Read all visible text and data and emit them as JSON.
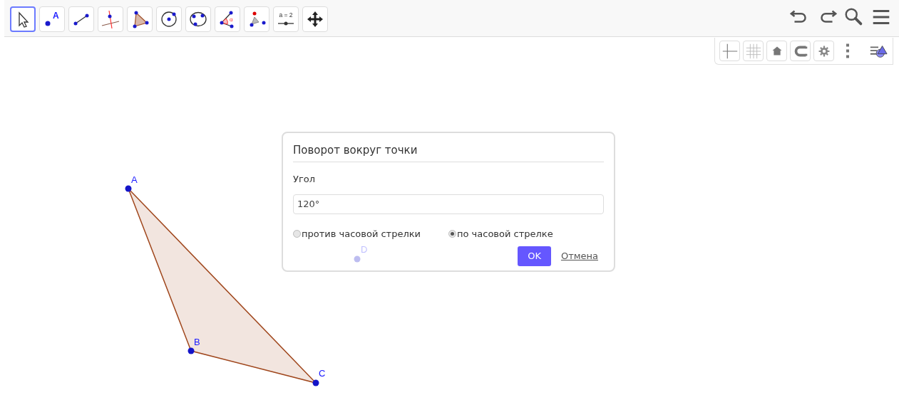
{
  "toolbar": {
    "tools": [
      {
        "kind": "move",
        "selected": true
      },
      {
        "kind": "point",
        "selected": false,
        "label": "A"
      },
      {
        "kind": "segment",
        "selected": false
      },
      {
        "kind": "perpendicular",
        "selected": false
      },
      {
        "kind": "polygon",
        "selected": false
      },
      {
        "kind": "circle",
        "selected": false
      },
      {
        "kind": "circle3",
        "selected": false
      },
      {
        "kind": "angle",
        "selected": false,
        "label": "α"
      },
      {
        "kind": "reflect",
        "selected": false
      },
      {
        "kind": "slider",
        "selected": false,
        "label": "a = 2"
      },
      {
        "kind": "pan",
        "selected": false
      }
    ],
    "actions": [
      {
        "kind": "undo"
      },
      {
        "kind": "redo"
      },
      {
        "kind": "search"
      },
      {
        "kind": "menu"
      }
    ]
  },
  "style_bar": [
    {
      "kind": "axes"
    },
    {
      "kind": "grid"
    },
    {
      "kind": "home"
    },
    {
      "kind": "magnet"
    },
    {
      "kind": "gear"
    },
    {
      "kind": "more"
    },
    {
      "kind": "style"
    }
  ],
  "canvas": {
    "points": [
      {
        "label": "A"
      },
      {
        "label": "B"
      },
      {
        "label": "C"
      },
      {
        "label": "D"
      }
    ]
  },
  "dialog": {
    "title": "Поворот вокруг точки",
    "field_label": "Угол",
    "value": "120°",
    "options": [
      {
        "label": "против часовой стрелки",
        "selected": false
      },
      {
        "label": "по часовой стрелке",
        "selected": true
      }
    ],
    "ok": "OK",
    "cancel": "Отмена"
  }
}
